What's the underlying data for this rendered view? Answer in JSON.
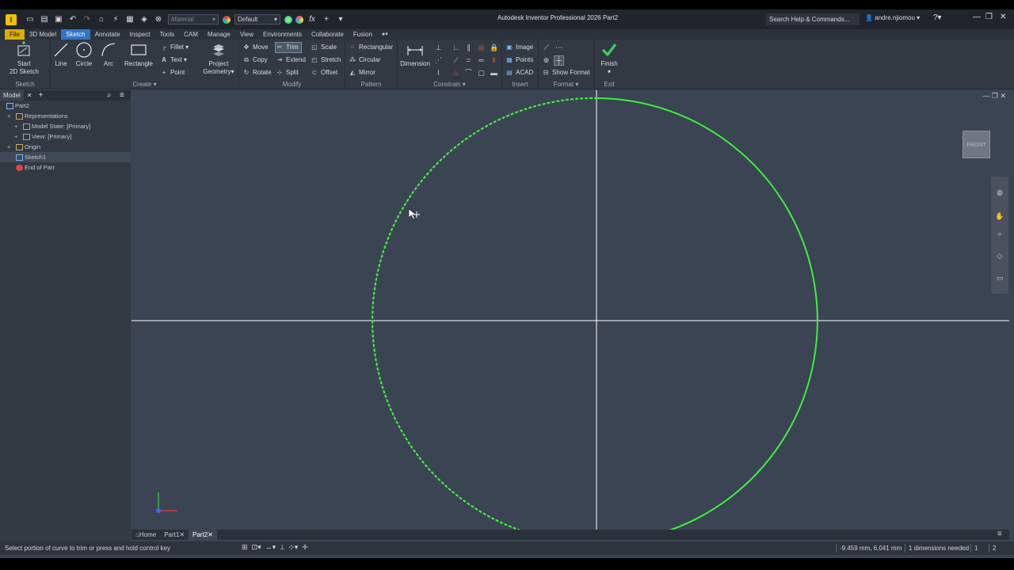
{
  "titlebar": {
    "material_placeholder": "Material",
    "appearance": "Default",
    "app_title": "Autodesk Inventor Professional 2026    Part2",
    "search_placeholder": "Search Help & Commands...",
    "user": "andre.njiomou"
  },
  "tabs": [
    "File",
    "3D Model",
    "Sketch",
    "Annotate",
    "Inspect",
    "Tools",
    "CAM",
    "Manage",
    "View",
    "Environments",
    "Collaborate",
    "Fusion"
  ],
  "active_tab": "Sketch",
  "ribbon": {
    "sketch_panel": {
      "title": "Sketch",
      "start_line1": "Start",
      "start_line2": "2D Sketch"
    },
    "create_panel": {
      "title": "Create",
      "line": "Line",
      "circle": "Circle",
      "arc": "Arc",
      "rectangle": "Rectangle",
      "fillet": "Fillet",
      "text": "Text",
      "point": "Point",
      "project_line1": "Project",
      "project_line2": "Geometry"
    },
    "modify_panel": {
      "title": "Modify",
      "move": "Move",
      "trim": "Trim",
      "scale": "Scale",
      "copy": "Copy",
      "extend": "Extend",
      "stretch": "Stretch",
      "rotate": "Rotate",
      "split": "Split",
      "offset": "Offset"
    },
    "pattern_panel": {
      "title": "Pattern",
      "rectangular": "Rectangular",
      "circular": "Circular",
      "mirror": "Mirror"
    },
    "constrain_panel": {
      "title": "Constrain",
      "dimension": "Dimension"
    },
    "insert_panel": {
      "title": "Insert",
      "image": "Image",
      "points": "Points",
      "acad": "ACAD"
    },
    "format_panel": {
      "title": "Format",
      "show_format": "Show Format"
    },
    "exit_panel": {
      "title": "Exit",
      "finish": "Finish"
    }
  },
  "browser": {
    "tab_label": "Model",
    "tree": [
      {
        "label": "Part2",
        "depth": 0,
        "icon": "part-icon"
      },
      {
        "label": "Representations",
        "depth": 1,
        "icon": "folder-icon"
      },
      {
        "label": "Model State: [Primary]",
        "depth": 2,
        "icon": "model-state-icon"
      },
      {
        "label": "View: [Primary]",
        "depth": 2,
        "icon": "view-icon"
      },
      {
        "label": "Origin",
        "depth": 1,
        "icon": "folder-icon"
      },
      {
        "label": "Sketch1",
        "depth": 1,
        "icon": "sketch-icon"
      },
      {
        "label": "End of Part",
        "depth": 1,
        "icon": "end-of-part-icon"
      }
    ]
  },
  "viewcube": {
    "face": "FRONT"
  },
  "doc_tabs": [
    "Home",
    "Part1",
    "Part2"
  ],
  "active_doc": "Part2",
  "status": {
    "message": "Select portion of curve to trim or press and hold control key",
    "coordinates": "-9.459 mm, 6.041 mm",
    "dimensions_needed": "1 dimensions needed",
    "count_a": "1",
    "count_b": "2"
  },
  "colors": {
    "canvas": "#3b4453",
    "sketch_curve": "#3cf03c",
    "axis": "#ffffff",
    "active_tab": "#2f75c5",
    "file_tab": "#d8b000"
  }
}
